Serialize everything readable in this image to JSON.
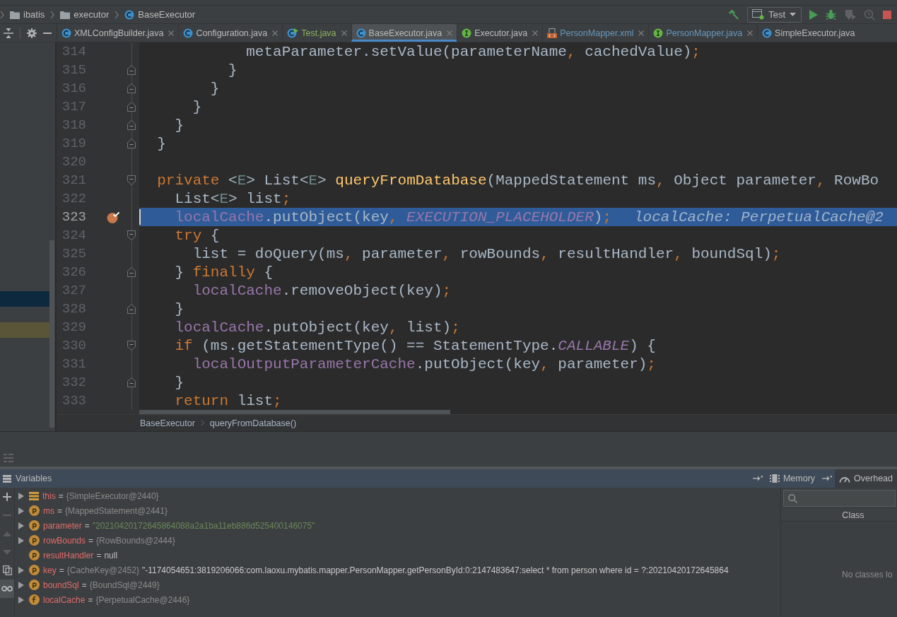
{
  "nav_bar": {
    "crumbs": [
      {
        "label": "ibatis",
        "kind": "folder"
      },
      {
        "label": "executor",
        "kind": "folder"
      },
      {
        "label": "BaseExecutor",
        "kind": "class"
      }
    ]
  },
  "run_toolbar": [
    {
      "kind": "build",
      "disabled": false
    },
    {
      "kind": "configuration",
      "label": "Test",
      "disabled": false
    },
    {
      "kind": "run",
      "disabled": false
    },
    {
      "kind": "debug",
      "disabled": false
    },
    {
      "kind": "coverage",
      "disabled": true
    },
    {
      "kind": "profile",
      "disabled": true
    },
    {
      "kind": "stop",
      "disabled": false
    }
  ],
  "tabs": [
    {
      "label": "XMLConfigBuilder.java",
      "kind": "class",
      "color": "#bbbbbb",
      "selected": false
    },
    {
      "label": "Configuration.java",
      "kind": "class",
      "color": "#bbbbbb",
      "selected": false
    },
    {
      "label": "Test.java",
      "kind": "runnable_class",
      "color": "#8db35c",
      "selected": false
    },
    {
      "label": "BaseExecutor.java",
      "kind": "class",
      "color": "#bbbbbb",
      "selected": true
    },
    {
      "label": "Executor.java",
      "kind": "interface",
      "color": "#bbbbbb",
      "selected": false
    },
    {
      "label": "PersonMapper.xml",
      "kind": "xml",
      "color": "#6897bb",
      "selected": false
    },
    {
      "label": "PersonMapper.java",
      "kind": "interface",
      "color": "#6897bb",
      "selected": false
    },
    {
      "label": "SimpleExecutor.java",
      "kind": "class",
      "color": "#bbbbbb",
      "selected": false
    }
  ],
  "project_tree": {
    "rows": [
      {
        "selected": false,
        "highlighted": false
      },
      {
        "selected": false,
        "highlighted": false
      },
      {
        "selected": false,
        "highlighted": false
      },
      {
        "selected": false,
        "highlighted": false
      },
      {
        "selected": false,
        "highlighted": false
      },
      {
        "selected": false,
        "highlighted": false
      },
      {
        "selected": false,
        "highlighted": false
      },
      {
        "selected": false,
        "highlighted": false
      },
      {
        "selected": false,
        "highlighted": false
      },
      {
        "selected": false,
        "highlighted": false
      },
      {
        "selected": false,
        "highlighted": false
      },
      {
        "selected": false,
        "highlighted": false
      },
      {
        "selected": false,
        "highlighted": false
      },
      {
        "selected": false,
        "highlighted": false
      },
      {
        "selected": false,
        "highlighted": false
      },
      {
        "selected": false,
        "highlighted": false
      },
      {
        "selected": true,
        "highlighted": false
      },
      {
        "selected": false,
        "highlighted": false
      },
      {
        "selected": false,
        "highlighted": true
      }
    ]
  },
  "editor": {
    "lines": [
      {
        "number": "314",
        "kind": "plain",
        "current": false,
        "breakpoint": false,
        "tokens": [
          {
            "text": "            metaParameter.setValue(parameterName",
            "kind": "plain"
          },
          {
            "text": ",",
            "kind": "punct"
          },
          {
            "text": " cachedValue)",
            "kind": "plain"
          },
          {
            "text": ";",
            "kind": "punct"
          }
        ]
      },
      {
        "number": "315",
        "kind": "fold_end",
        "current": false,
        "breakpoint": false,
        "tokens": [
          {
            "text": "          }",
            "kind": "plain"
          }
        ]
      },
      {
        "number": "316",
        "kind": "fold_end",
        "current": false,
        "breakpoint": false,
        "tokens": [
          {
            "text": "        }",
            "kind": "plain"
          }
        ]
      },
      {
        "number": "317",
        "kind": "fold_end",
        "current": false,
        "breakpoint": false,
        "tokens": [
          {
            "text": "      }",
            "kind": "plain"
          }
        ]
      },
      {
        "number": "318",
        "kind": "fold_end",
        "current": false,
        "breakpoint": false,
        "tokens": [
          {
            "text": "    }",
            "kind": "plain"
          }
        ]
      },
      {
        "number": "319",
        "kind": "fold_end",
        "current": false,
        "breakpoint": false,
        "tokens": [
          {
            "text": "  }",
            "kind": "plain"
          }
        ]
      },
      {
        "number": "320",
        "kind": "plain",
        "current": false,
        "breakpoint": false
      },
      {
        "number": "321",
        "kind": "fold_start",
        "current": false,
        "breakpoint": false,
        "tokens": [
          {
            "text": "  private",
            "kind": "keyword"
          },
          {
            "text": " <",
            "kind": "plain"
          },
          {
            "text": "E",
            "kind": "typeparam"
          },
          {
            "text": "> List<",
            "kind": "plain"
          },
          {
            "text": "E",
            "kind": "typeparam"
          },
          {
            "text": "> ",
            "kind": "plain"
          },
          {
            "text": "queryFromDatabase",
            "kind": "method"
          },
          {
            "text": "(MappedStatement ms",
            "kind": "plain"
          },
          {
            "text": ",",
            "kind": "punct"
          },
          {
            "text": " Object parameter",
            "kind": "plain"
          },
          {
            "text": ",",
            "kind": "punct"
          },
          {
            "text": " RowBo",
            "kind": "plain"
          }
        ]
      },
      {
        "number": "322",
        "kind": "plain",
        "current": false,
        "breakpoint": false,
        "tokens": [
          {
            "text": "    List<",
            "kind": "plain"
          },
          {
            "text": "E",
            "kind": "typeparam"
          },
          {
            "text": "> list",
            "kind": "plain"
          },
          {
            "text": ";",
            "kind": "punct"
          }
        ]
      },
      {
        "number": "323",
        "kind": "plain",
        "current": true,
        "breakpoint": true,
        "tokens": [
          {
            "text": "    localCache",
            "kind": "field"
          },
          {
            "text": ".putObject(key",
            "kind": "plain"
          },
          {
            "text": ", ",
            "kind": "punct"
          },
          {
            "text": "EXECUTION_PLACEHOLDER",
            "kind": "constant"
          },
          {
            "text": ")",
            "kind": "plain"
          },
          {
            "text": ";",
            "kind": "punct"
          }
        ],
        "inline_value": "localCache: PerpetualCache@2"
      },
      {
        "number": "324",
        "kind": "fold_start",
        "current": false,
        "breakpoint": false,
        "tokens": [
          {
            "text": "    try",
            "kind": "keyword"
          },
          {
            "text": " {",
            "kind": "plain"
          }
        ]
      },
      {
        "number": "325",
        "kind": "plain",
        "current": false,
        "breakpoint": false,
        "tokens": [
          {
            "text": "      list = doQuery(ms",
            "kind": "plain"
          },
          {
            "text": ",",
            "kind": "punct"
          },
          {
            "text": " parameter",
            "kind": "plain"
          },
          {
            "text": ",",
            "kind": "punct"
          },
          {
            "text": " rowBounds",
            "kind": "plain"
          },
          {
            "text": ",",
            "kind": "punct"
          },
          {
            "text": " resultHandler",
            "kind": "plain"
          },
          {
            "text": ",",
            "kind": "punct"
          },
          {
            "text": " boundSql)",
            "kind": "plain"
          },
          {
            "text": ";",
            "kind": "punct"
          }
        ]
      },
      {
        "number": "326",
        "kind": "fold_end",
        "current": false,
        "breakpoint": false,
        "tokens": [
          {
            "text": "    } ",
            "kind": "plain"
          },
          {
            "text": "finally",
            "kind": "keyword"
          },
          {
            "text": " {",
            "kind": "plain"
          }
        ]
      },
      {
        "number": "327",
        "kind": "plain",
        "current": false,
        "breakpoint": false,
        "tokens": [
          {
            "text": "      localCache",
            "kind": "field"
          },
          {
            "text": ".removeObject(key)",
            "kind": "plain"
          },
          {
            "text": ";",
            "kind": "punct"
          }
        ]
      },
      {
        "number": "328",
        "kind": "fold_end",
        "current": false,
        "breakpoint": false,
        "tokens": [
          {
            "text": "    }",
            "kind": "plain"
          }
        ]
      },
      {
        "number": "329",
        "kind": "plain",
        "current": false,
        "breakpoint": false,
        "tokens": [
          {
            "text": "    localCache",
            "kind": "field"
          },
          {
            "text": ".putObject(key",
            "kind": "plain"
          },
          {
            "text": ",",
            "kind": "punct"
          },
          {
            "text": " list)",
            "kind": "plain"
          },
          {
            "text": ";",
            "kind": "punct"
          }
        ]
      },
      {
        "number": "330",
        "kind": "fold_start",
        "current": false,
        "breakpoint": false,
        "tokens": [
          {
            "text": "    if",
            "kind": "keyword"
          },
          {
            "text": " (ms.getStatementType() == StatementType.",
            "kind": "plain"
          },
          {
            "text": "CALLABLE",
            "kind": "constant"
          },
          {
            "text": ") {",
            "kind": "plain"
          }
        ]
      },
      {
        "number": "331",
        "kind": "plain",
        "current": false,
        "breakpoint": false,
        "tokens": [
          {
            "text": "      localOutputParameterCache",
            "kind": "field"
          },
          {
            "text": ".putObject(key",
            "kind": "plain"
          },
          {
            "text": ",",
            "kind": "punct"
          },
          {
            "text": " parameter)",
            "kind": "plain"
          },
          {
            "text": ";",
            "kind": "punct"
          }
        ]
      },
      {
        "number": "332",
        "kind": "fold_end",
        "current": false,
        "breakpoint": false,
        "tokens": [
          {
            "text": "    }",
            "kind": "plain"
          }
        ]
      },
      {
        "number": "333",
        "kind": "plain",
        "current": false,
        "breakpoint": false,
        "tokens": [
          {
            "text": "    return",
            "kind": "keyword"
          },
          {
            "text": " list",
            "kind": "plain"
          },
          {
            "text": ";",
            "kind": "punct"
          }
        ]
      }
    ],
    "breadcrumbs": [
      "BaseExecutor",
      "queryFromDatabase()"
    ]
  },
  "debugger": {
    "title": "Variables",
    "side_tabs": [
      {
        "label": "Memory",
        "kind": "memory",
        "selected": false
      },
      {
        "label": "Overhead",
        "kind": "overhead",
        "selected": true
      }
    ],
    "toolbar": [
      {
        "kind": "add",
        "disabled": false,
        "on": false
      },
      {
        "kind": "remove",
        "disabled": true,
        "on": false
      },
      {
        "kind": "up",
        "disabled": true,
        "on": false
      },
      {
        "kind": "down",
        "disabled": true,
        "on": false
      },
      {
        "kind": "copy",
        "disabled": false,
        "on": false
      },
      {
        "kind": "watch",
        "disabled": false,
        "on": true
      }
    ],
    "variables": [
      {
        "name": "this",
        "kind": "this",
        "expandable": true,
        "assign": "=",
        "value": {
          "text": "{SimpleExecutor@2440}",
          "kind": "object"
        }
      },
      {
        "name": "ms",
        "kind": "parameter",
        "expandable": true,
        "assign": "=",
        "value": {
          "text": "{MappedStatement@2441}",
          "kind": "object"
        }
      },
      {
        "name": "parameter",
        "kind": "parameter",
        "expandable": true,
        "assign": "=",
        "value": {
          "text": "\"20210420172645864088a2a1ba11eb886d525400146075\"",
          "kind": "string"
        }
      },
      {
        "name": "rowBounds",
        "kind": "parameter",
        "expandable": true,
        "assign": "=",
        "value": {
          "text": "{RowBounds@2444}",
          "kind": "object"
        }
      },
      {
        "name": "resultHandler",
        "kind": "parameter",
        "expandable": false,
        "assign": "=",
        "value": {
          "text": "null",
          "kind": "null"
        }
      },
      {
        "name": "key",
        "kind": "parameter",
        "expandable": true,
        "assign": "=",
        "value": {
          "text": "{CacheKey@2452}",
          "kind": "object"
        },
        "detail": "\"-1174054651:3819206066:com.laoxu.mybatis.mapper.PersonMapper.getPersonById:0:2147483647:select * from person where id = ?:20210420172645864"
      },
      {
        "name": "boundSql",
        "kind": "parameter",
        "expandable": true,
        "assign": "=",
        "value": {
          "text": "{BoundSql@2449}",
          "kind": "object"
        }
      },
      {
        "name": "localCache",
        "kind": "field",
        "expandable": true,
        "assign": "=",
        "value": {
          "text": "{PerpetualCache@2446}",
          "kind": "object"
        }
      }
    ],
    "classes": {
      "column": "Class",
      "empty_text": "No classes lo"
    }
  }
}
